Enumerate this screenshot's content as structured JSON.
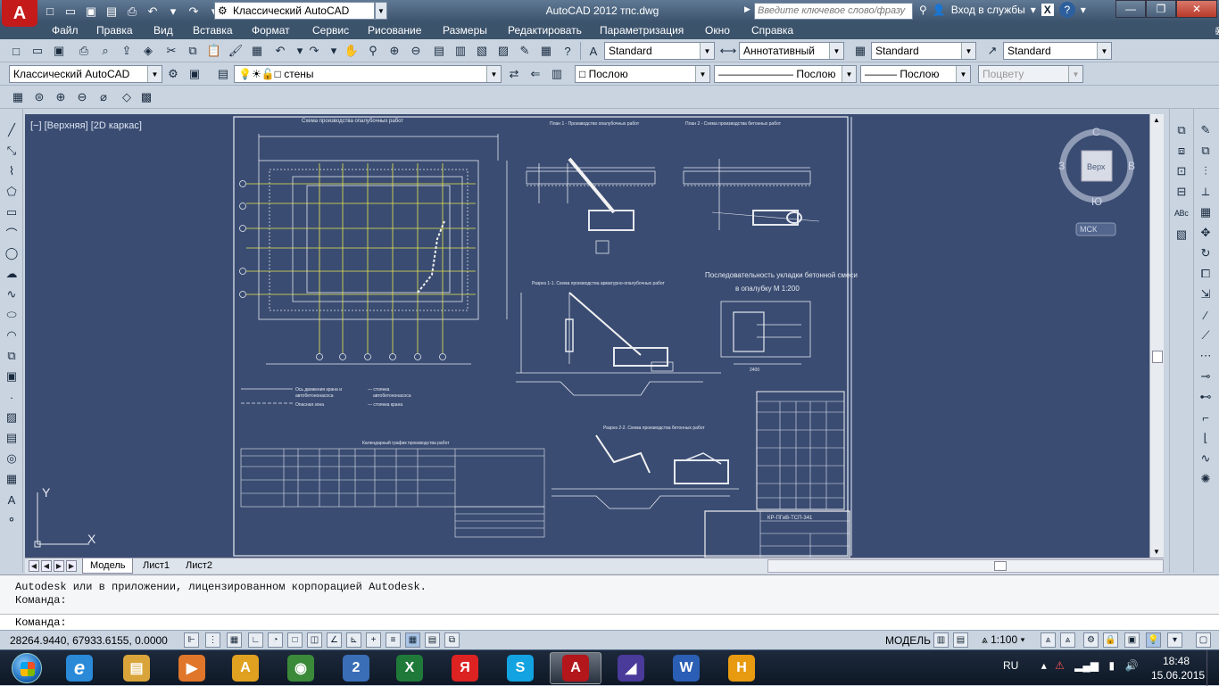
{
  "titlebar": {
    "app_letter": "A",
    "workspace": "Классический AutoCAD",
    "title": "AutoCAD 2012    тпс.dwg",
    "search_placeholder": "Введите ключевое слово/фразу",
    "login": "Вход в службы",
    "help": "?",
    "min": "—",
    "max": "❐",
    "close": "✕"
  },
  "menu": {
    "items": [
      "Файл",
      "Правка",
      "Вид",
      "Вставка",
      "Формат",
      "Сервис",
      "Рисование",
      "Размеры",
      "Редактировать",
      "Параметризация",
      "Окно",
      "Справка"
    ],
    "ctl_min": "—",
    "ctl_max": "❐",
    "ctl_close": "✕"
  },
  "toolbar1": {
    "text_style": "Standard",
    "annot_style": "Аннотативный",
    "table_style": "Standard",
    "mleader_style": "Standard"
  },
  "toolbar2": {
    "workspace": "Классический AutoCAD",
    "layer": "стены",
    "color": "Послою",
    "linetype": "Послою",
    "lineweight": "Послою",
    "plotstyle": "Поцвету"
  },
  "viewport": {
    "label": "[−] [Верхняя] [2D каркас]",
    "background": "#3a4c72",
    "viewcube": {
      "n": "С",
      "s": "Ю",
      "w": "З",
      "e": "В",
      "top": "Верх",
      "ucs": "МСК"
    },
    "ucs_y": "Y",
    "ucs_x": "X",
    "drawing": {
      "sheet_title_main": "Схема производства опалубочных работ",
      "plan1": "План 1 - Производство опалубочных работ",
      "plan2": "План 2 - Схема производства бетонных работ",
      "section1": "Разрез  1-1. Схема производства арматурно-опалубочных работ",
      "section2": "Разрез  2-2. Схема производства бетонных работ",
      "concrete_title": "Последовательность укладки бетонной смеси",
      "concrete_sub": "в опалубку М 1:200",
      "schedule_title": "Календарный график производства работ",
      "legend1": "Ось движения крана и",
      "legend1b": "автобетононасоса",
      "legend2": "Опасная зона",
      "legend3": "— стоянка",
      "legend3b": "автобетононасоса",
      "legend4": "— стоянка крана",
      "stamp_code": "КР-ПГиВ-ТСП-341",
      "dim_2400": "2400"
    }
  },
  "layouts": {
    "tabs": [
      "Модель",
      "Лист1",
      "Лист2"
    ],
    "active": "Модель"
  },
  "command": {
    "line1": "Autodesk или в приложении, лицензированном корпорацией Autodesk.",
    "line2": "Команда:",
    "prompt": "Команда:"
  },
  "status": {
    "coords": "28264.9440, 67933.6155, 0.0000",
    "model": "МОДЕЛЬ",
    "scale": "1:100"
  },
  "taskbar": {
    "lang": "RU",
    "time": "18:48",
    "date": "15.06.2015",
    "apps": [
      {
        "name": "explorer",
        "letter": "▤",
        "color": "#d9a53a"
      },
      {
        "name": "media",
        "letter": "▶",
        "color": "#e0762a"
      },
      {
        "name": "archicad",
        "letter": "A",
        "color": "#e0a020"
      },
      {
        "name": "chrome",
        "letter": "◉",
        "color": "#3a8a3a"
      },
      {
        "name": "app-2",
        "letter": "2",
        "color": "#3a6fb8"
      },
      {
        "name": "excel",
        "letter": "X",
        "color": "#1f7a3a"
      },
      {
        "name": "yandex",
        "letter": "Я",
        "color": "#d22"
      },
      {
        "name": "skype",
        "letter": "S",
        "color": "#12a3e0"
      },
      {
        "name": "autocad",
        "letter": "A",
        "color": "#b3161b"
      },
      {
        "name": "vector-app",
        "letter": "◢",
        "color": "#4a3a9a"
      },
      {
        "name": "word",
        "letter": "W",
        "color": "#2b5fb5"
      },
      {
        "name": "h-app",
        "letter": "H",
        "color": "#e89a10"
      }
    ]
  }
}
